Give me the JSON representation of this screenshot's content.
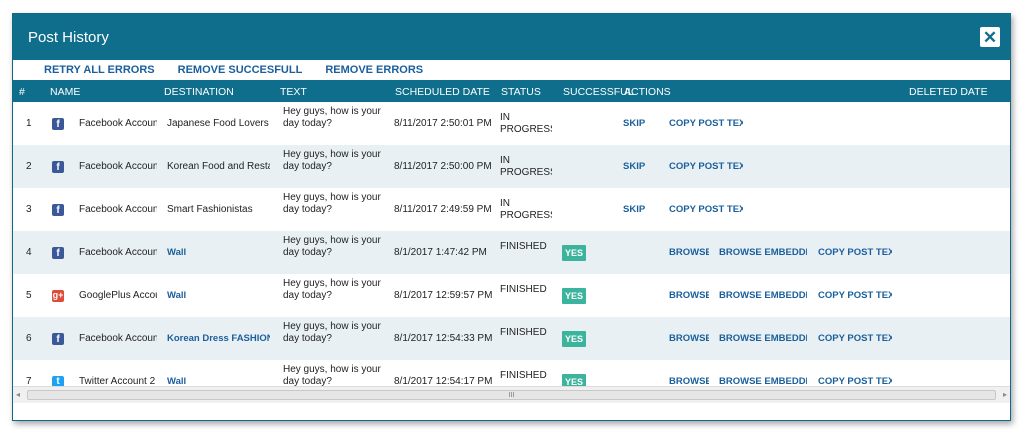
{
  "dialog": {
    "title": "Post History",
    "close_icon": "close-icon"
  },
  "actions": {
    "retry_all_errors": "RETRY ALL ERRORS",
    "remove_successful": "REMOVE SUCCESFULL",
    "remove_errors": "REMOVE ERRORS"
  },
  "columns": {
    "num": "#",
    "name": "NAME",
    "destination": "DESTINATION",
    "text": "TEXT",
    "scheduled_date": "SCHEDULED DATE",
    "status": "STATUS",
    "successful": "SUCCESSFUL",
    "actions": "ACTIONS",
    "deleted_date": "DELETED DATE"
  },
  "rows": [
    {
      "num": "1",
      "network": "facebook",
      "icon": "f",
      "name": "Facebook Account",
      "destination": "Japanese Food Lovers by",
      "dest_link": false,
      "text": "Hey guys, how is your day today?",
      "scheduled": "8/11/2017 2:50:01 PM",
      "status": "IN PROGRESS",
      "successful": "",
      "skip": "SKIP",
      "browse": "",
      "browse_embedded": "",
      "copy": "COPY POST TEXT"
    },
    {
      "num": "2",
      "network": "facebook",
      "icon": "f",
      "name": "Facebook Account",
      "destination": "Korean Food and Restaur",
      "dest_link": false,
      "text": "Hey guys, how is your day today?",
      "scheduled": "8/11/2017 2:50:00 PM",
      "status": "IN PROGRESS",
      "successful": "",
      "skip": "SKIP",
      "browse": "",
      "browse_embedded": "",
      "copy": "COPY POST TEXT"
    },
    {
      "num": "3",
      "network": "facebook",
      "icon": "f",
      "name": "Facebook Account",
      "destination": "Smart Fashionistas",
      "dest_link": false,
      "text": "Hey guys, how is your day today?",
      "scheduled": "8/11/2017 2:49:59 PM",
      "status": "IN PROGRESS",
      "successful": "",
      "skip": "SKIP",
      "browse": "",
      "browse_embedded": "",
      "copy": "COPY POST TEXT"
    },
    {
      "num": "4",
      "network": "facebook",
      "icon": "f",
      "name": "Facebook Account",
      "destination": "Wall",
      "dest_link": true,
      "text": "Hey guys, how is your day today?",
      "scheduled": "8/1/2017 1:47:42 PM",
      "status": "FINISHED",
      "successful": "YES",
      "skip": "",
      "browse": "BROWSE",
      "browse_embedded": "BROWSE EMBEDDED",
      "copy": "COPY POST TEXT"
    },
    {
      "num": "5",
      "network": "googleplus",
      "icon": "g+",
      "name": "GooglePlus Accou",
      "destination": "Wall",
      "dest_link": true,
      "text": "Hey guys, how is your day today?",
      "scheduled": "8/1/2017 12:59:57 PM",
      "status": "FINISHED",
      "successful": "YES",
      "skip": "",
      "browse": "BROWSE",
      "browse_embedded": "BROWSE EMBEDDED",
      "copy": "COPY POST TEXT"
    },
    {
      "num": "6",
      "network": "facebook",
      "icon": "f",
      "name": "Facebook Account",
      "destination": "Korean Dress FASHION°",
      "dest_link": true,
      "text": "Hey guys, how is your day today?",
      "scheduled": "8/1/2017 12:54:33 PM",
      "status": "FINISHED",
      "successful": "YES",
      "skip": "",
      "browse": "BROWSE",
      "browse_embedded": "BROWSE EMBEDDED",
      "copy": "COPY POST TEXT"
    },
    {
      "num": "7",
      "network": "twitter",
      "icon": "t",
      "name": "Twitter Account 2",
      "destination": "Wall",
      "dest_link": true,
      "text": "Hey guys, how is your day today?",
      "scheduled": "8/1/2017 12:54:17 PM",
      "status": "FINISHED",
      "successful": "YES",
      "skip": "",
      "browse": "BROWSE",
      "browse_embedded": "BROWSE EMBEDDED",
      "copy": "COPY POST TEXT"
    }
  ],
  "scrollbar": {
    "left_arrow": "◂",
    "right_arrow": "▸",
    "grip": "III"
  },
  "colors": {
    "header": "#0f6e8c",
    "link": "#1a5f9c",
    "success": "#3cb49d",
    "row_alt": "#e9f0f4"
  }
}
